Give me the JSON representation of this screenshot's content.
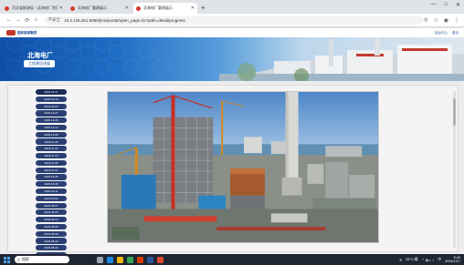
{
  "browser": {
    "tabs": [
      {
        "label": "河北省能源局（北海电厂首页）",
        "active": false
      },
      {
        "label": "北海电厂重建展示",
        "active": false
      },
      {
        "label": "北海电厂重建展示",
        "active": true
      }
    ],
    "new_tab": "+",
    "window_controls": [
      "—",
      "□",
      "✕"
    ],
    "security_label": "不安全",
    "url": "10.3.126.251:8080/jmis/portal/open_page.do?path=detail/progress",
    "nav": [
      "←",
      "→",
      "⟳",
      "⌂"
    ]
  },
  "site": {
    "logo_text": "国家能源集团",
    "links": [
      "后台中心",
      "退出"
    ]
  },
  "banner": {
    "title": "北海电厂",
    "button_label": "工程建设进展"
  },
  "dates": [
    "2024.01.17",
    "2024.01.10",
    "2024.01.03",
    "2023.12.27",
    "2023.12.20",
    "2023.12.13",
    "2023.12.06",
    "2023.11.29",
    "2023.11.22",
    "2023.11.15",
    "2023.11.08",
    "2023.11.01",
    "2023.10.25",
    "2023.10.18",
    "2023.10.11",
    "2023.10.04",
    "2023.09.27",
    "2023.09.20",
    "2023.09.13",
    "2023.09.06",
    "2023.08.30",
    "2023.08.23",
    "2023.08.16",
    "2023.08.09",
    "2023.08.02",
    "2023.07.26"
  ],
  "taskbar": {
    "search_placeholder": "搜索",
    "weather": "26°C 晴",
    "time": "9:40",
    "date": "2024/1/17"
  },
  "colors": {
    "banner_blue": "#0e4fa8",
    "pill": "#2a3f73",
    "taskbar": "#1f2633"
  }
}
